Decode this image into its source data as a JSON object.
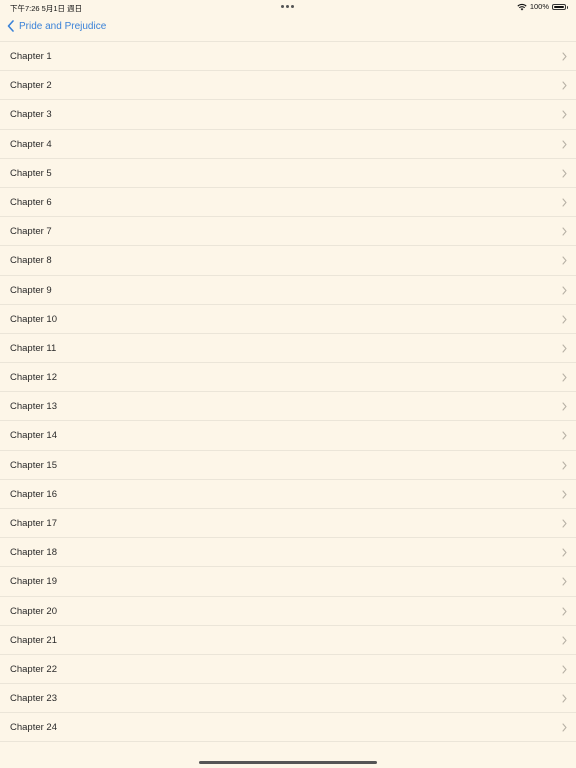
{
  "status_bar": {
    "time": "下午7:26  5月1日 週日",
    "battery_text": "100%",
    "battery_level": 1.0
  },
  "nav": {
    "back_label": "Pride and Prejudice",
    "back_icon": "chevron-left-icon",
    "accent_color": "#3a82d8"
  },
  "chapters": [
    "Chapter 1",
    "Chapter 2",
    "Chapter 3",
    "Chapter 4",
    "Chapter 5",
    "Chapter 6",
    "Chapter 7",
    "Chapter 8",
    "Chapter 9",
    "Chapter 10",
    "Chapter 11",
    "Chapter 12",
    "Chapter 13",
    "Chapter 14",
    "Chapter 15",
    "Chapter 16",
    "Chapter 17",
    "Chapter 18",
    "Chapter 19",
    "Chapter 20",
    "Chapter 21",
    "Chapter 22",
    "Chapter 23",
    "Chapter 24"
  ],
  "row_icon": "chevron-right-icon",
  "background_color": "#fdf6e8"
}
